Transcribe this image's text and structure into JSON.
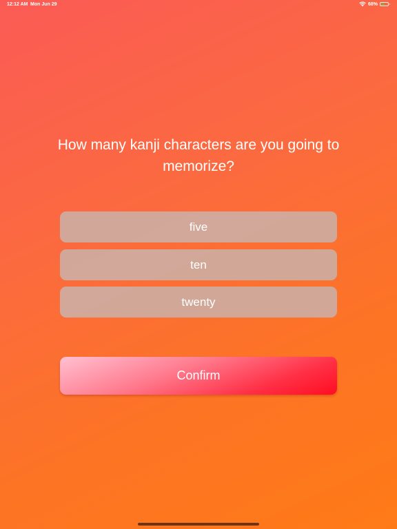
{
  "status_bar": {
    "time": "12:12 AM",
    "date": "Mon Jun 29",
    "battery": "68%",
    "icons": [
      "wifi-icon",
      "battery-icon"
    ],
    "battery_level": 0.68
  },
  "question": {
    "text": "How many kanji characters are you going to memorize?"
  },
  "options": [
    {
      "label": "five"
    },
    {
      "label": "ten"
    },
    {
      "label": "twenty"
    }
  ],
  "confirm": {
    "label": "Confirm"
  },
  "colors": {
    "background_start": "#fb5b55",
    "background_end": "#ff7a17",
    "option_bg": "#cdaca0",
    "confirm_start": "#ffc1d2",
    "confirm_end": "#ff0d22"
  }
}
